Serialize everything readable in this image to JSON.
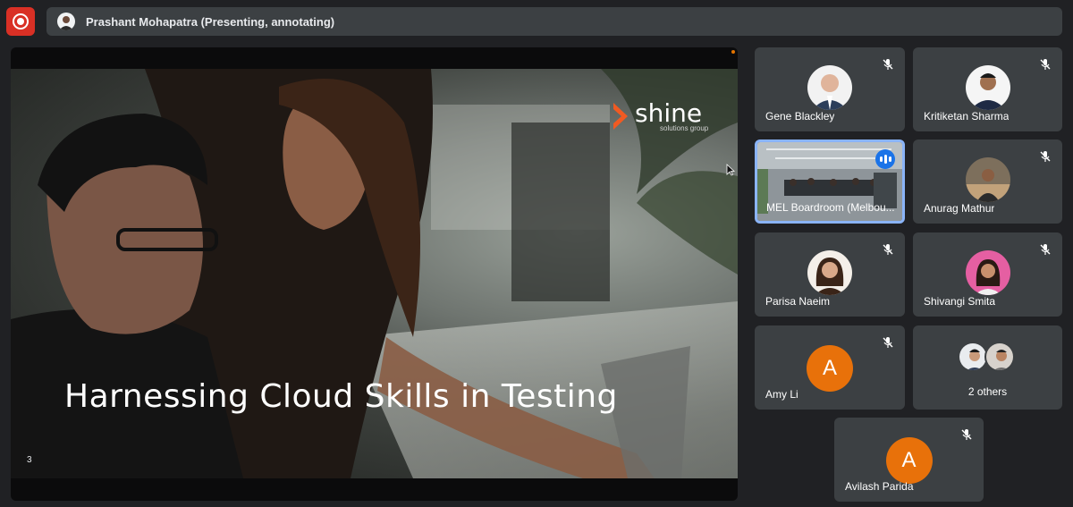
{
  "header": {
    "record_icon": "record-icon",
    "presenter_label": "Prashant Mohapatra (Presenting, annotating)"
  },
  "presentation": {
    "title": "Harnessing Cloud Skills in Testing",
    "page_number": "3",
    "brand_name": "shine",
    "brand_tagline": "solutions group"
  },
  "participants": [
    {
      "name": "Gene Blackley",
      "muted": true
    },
    {
      "name": "Kritiketan Sharma",
      "muted": true
    },
    {
      "name": "MEL Boardroom (Melbou...",
      "muted": false,
      "speaking": true
    },
    {
      "name": "Anurag Mathur",
      "muted": true
    },
    {
      "name": "Parisa Naeim",
      "muted": true
    },
    {
      "name": "Shivangi Smita",
      "muted": true
    },
    {
      "name": "Amy Li",
      "muted": true,
      "initial": "A"
    },
    {
      "name": "2 others",
      "muted": false
    },
    {
      "name": "Avilash Parida",
      "muted": true,
      "initial": "A"
    }
  ],
  "colors": {
    "background": "#202124",
    "tile": "#3c4043",
    "record": "#d93025",
    "active_border": "#8ab4f8",
    "avatar_orange": "#e8710a",
    "brand_orange": "#f15a22"
  }
}
